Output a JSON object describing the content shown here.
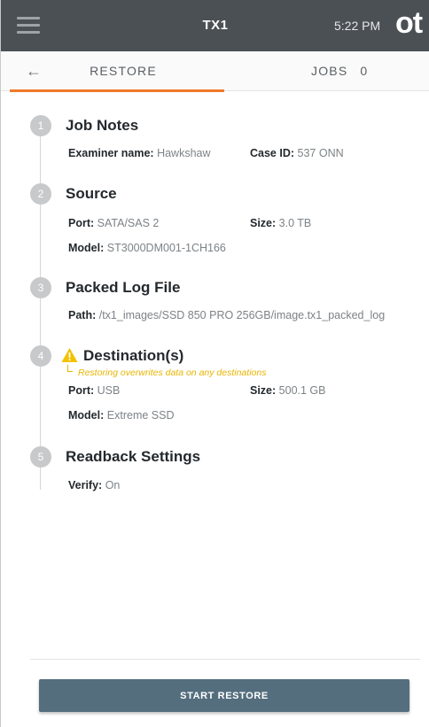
{
  "topbar": {
    "app_title": "TX1",
    "time": "5:22 PM",
    "logo_text": "ot"
  },
  "tabs": {
    "restore_label": "RESTORE",
    "jobs_label": "JOBS",
    "jobs_count": "0",
    "active_tab": "RESTORE"
  },
  "steps": {
    "job_notes": {
      "number": "1",
      "title": "Job Notes",
      "examiner_label": "Examiner name:",
      "examiner_value": "Hawkshaw",
      "case_label": "Case ID:",
      "case_value": "537 ONN"
    },
    "source": {
      "number": "2",
      "title": "Source",
      "port_label": "Port:",
      "port_value": "SATA/SAS 2",
      "size_label": "Size:",
      "size_value": "3.0 TB",
      "model_label": "Model:",
      "model_value": "ST3000DM001-1CH166"
    },
    "packed_log": {
      "number": "3",
      "title": "Packed Log File",
      "path_label": "Path:",
      "path_value": "/tx1_images/SSD 850 PRO 256GB/image.tx1_packed_log"
    },
    "destination": {
      "number": "4",
      "title": "Destination(s)",
      "warning": "Restoring overwrites data on any destinations",
      "port_label": "Port:",
      "port_value": "USB",
      "size_label": "Size:",
      "size_value": "500.1 GB",
      "model_label": "Model:",
      "model_value": "Extreme SSD"
    },
    "readback": {
      "number": "5",
      "title": "Readback Settings",
      "verify_label": "Verify:",
      "verify_value": "On"
    }
  },
  "actions": {
    "start_restore": "START RESTORE"
  },
  "colors": {
    "topbar_bg": "#4b5054",
    "accent_orange": "#f07a2a",
    "warning_yellow": "#e9b500",
    "button_bg": "#546e7e"
  },
  "icons": {
    "menu": "hamburger-icon",
    "back": "arrow-left-icon",
    "warning": "warning-triangle-icon"
  }
}
